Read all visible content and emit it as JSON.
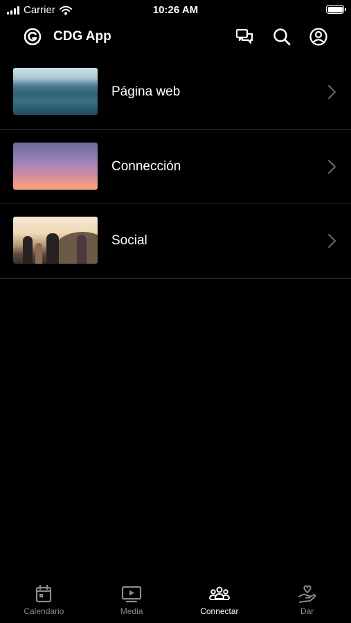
{
  "status_bar": {
    "carrier": "Carrier",
    "time": "10:26 AM"
  },
  "header": {
    "title": "CDG App",
    "icons": [
      "logo-icon",
      "chat-icon",
      "search-icon",
      "account-icon"
    ]
  },
  "list": {
    "items": [
      {
        "label": "Página web",
        "image": "ocean-waves"
      },
      {
        "label": "Connección",
        "image": "sunset-sky"
      },
      {
        "label": "Social",
        "image": "group-of-friends"
      }
    ]
  },
  "tab_bar": {
    "active": "Connectar",
    "tabs": [
      {
        "label": "Calendario",
        "icon": "calendar-icon"
      },
      {
        "label": "Media",
        "icon": "play-icon"
      },
      {
        "label": "Connectar",
        "icon": "people-icon"
      },
      {
        "label": "Dar",
        "icon": "giving-hand-icon"
      }
    ]
  },
  "colors": {
    "background": "#000000",
    "text": "#ffffff",
    "inactive_tab": "#8a8a8a",
    "divider": "#2f2f2f"
  }
}
